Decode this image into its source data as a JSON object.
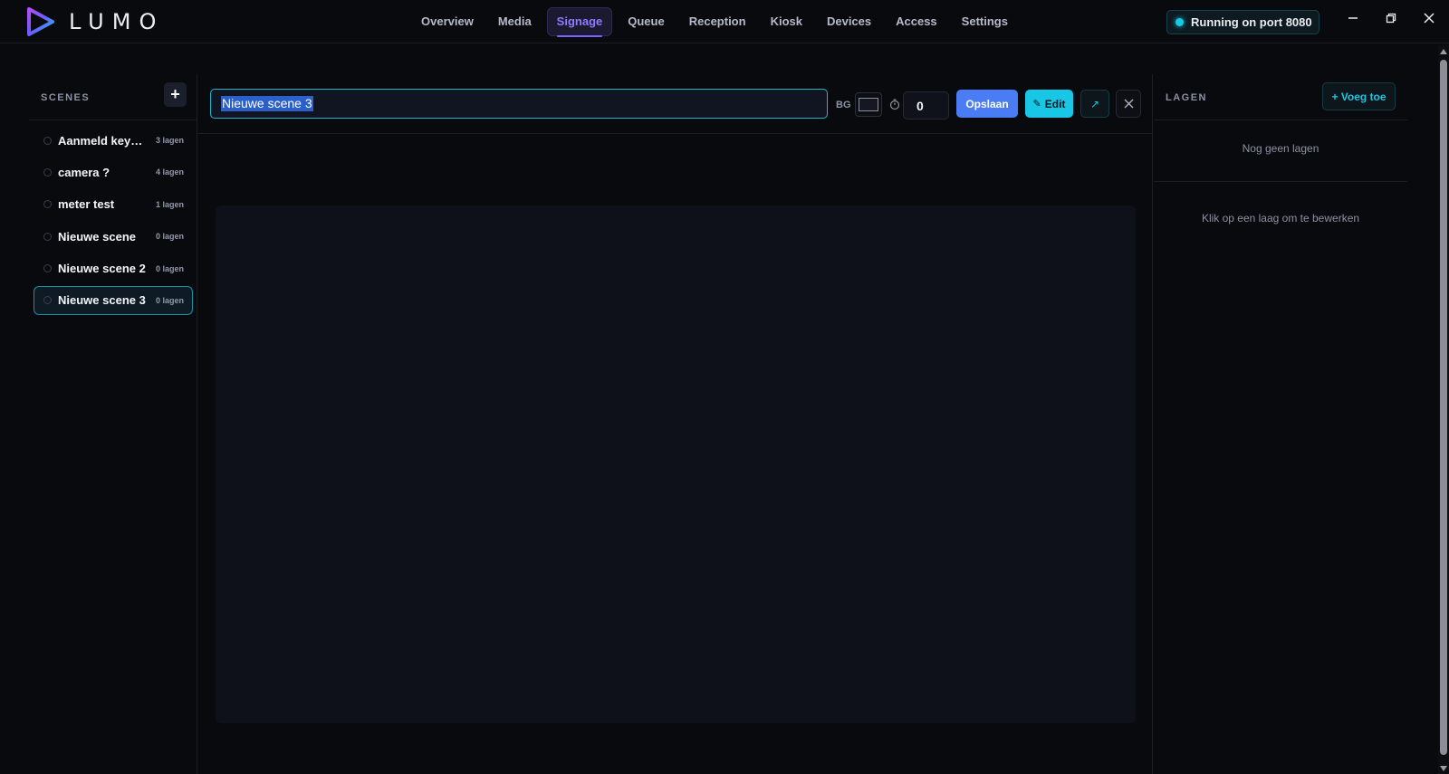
{
  "app": {
    "brand": "LUMO"
  },
  "nav": {
    "items": [
      {
        "label": "Overview"
      },
      {
        "label": "Media"
      },
      {
        "label": "Signage",
        "active": true
      },
      {
        "label": "Queue"
      },
      {
        "label": "Reception"
      },
      {
        "label": "Kiosk"
      },
      {
        "label": "Devices"
      },
      {
        "label": "Access"
      },
      {
        "label": "Settings"
      }
    ]
  },
  "status": {
    "text": "Running on port 8080",
    "color": "#17c9e5"
  },
  "scenes": {
    "title": "SCENES",
    "add_label": "+",
    "items": [
      {
        "name": "Aanmeld keyp…",
        "count": "3 lagen"
      },
      {
        "name": "camera ?",
        "count": "4 lagen"
      },
      {
        "name": "meter test",
        "count": "1 lagen"
      },
      {
        "name": "Nieuwe scene",
        "count": "0 lagen"
      },
      {
        "name": "Nieuwe scene 2",
        "count": "0 lagen"
      },
      {
        "name": "Nieuwe scene 3",
        "count": "0 lagen",
        "selected": true
      }
    ]
  },
  "editor": {
    "scene_title": "Nieuwe scene 3",
    "bg_label": "BG",
    "bg_color": "#151823",
    "duration": "0",
    "save_label": "Opslaan",
    "edit_label": "Edit",
    "popout_icon": "↗",
    "close_icon": "✕"
  },
  "layers": {
    "title": "LAGEN",
    "add_label": "+ Voeg toe",
    "empty_text": "Nog geen lagen",
    "hint_text": "Klik op een laag om te bewerken"
  },
  "colors": {
    "accent_cyan": "#18c6e6",
    "accent_blue": "#4a7cf4",
    "accent_purple": "#8f7bff"
  }
}
